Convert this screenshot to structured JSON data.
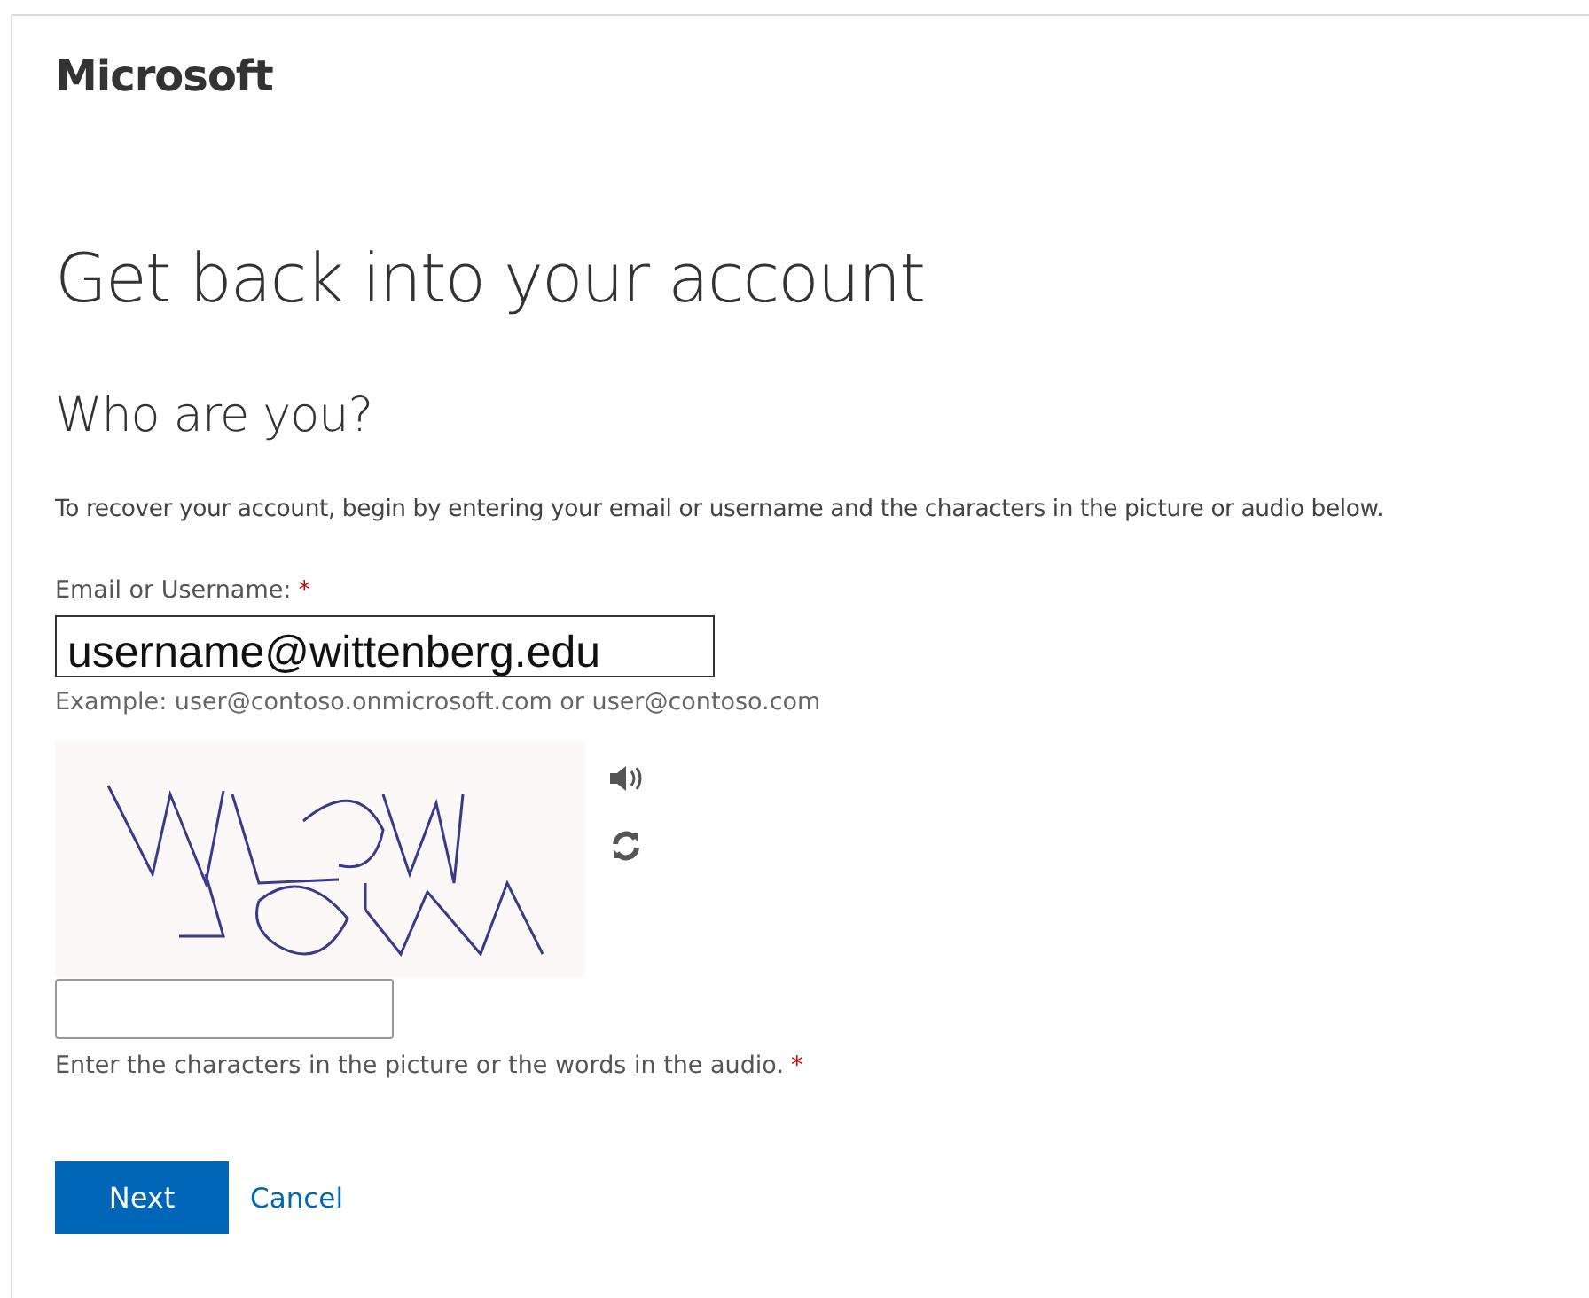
{
  "brand": "Microsoft",
  "title": "Get back into your account",
  "subtitle": "Who are you?",
  "description": "To recover your account, begin by entering your email or username and the characters in the picture or audio below.",
  "email_field": {
    "label": "Email or Username:",
    "required_mark": "*",
    "value": "username@wittenberg.edu",
    "example": "Example: user@contoso.onmicrosoft.com or user@contoso.com"
  },
  "captcha_field": {
    "label": "Enter the characters in the picture or the words in the audio.",
    "required_mark": "*"
  },
  "buttons": [
    {
      "kind": "primary",
      "label": "Next"
    },
    {
      "kind": "link",
      "label": "Cancel"
    }
  ]
}
